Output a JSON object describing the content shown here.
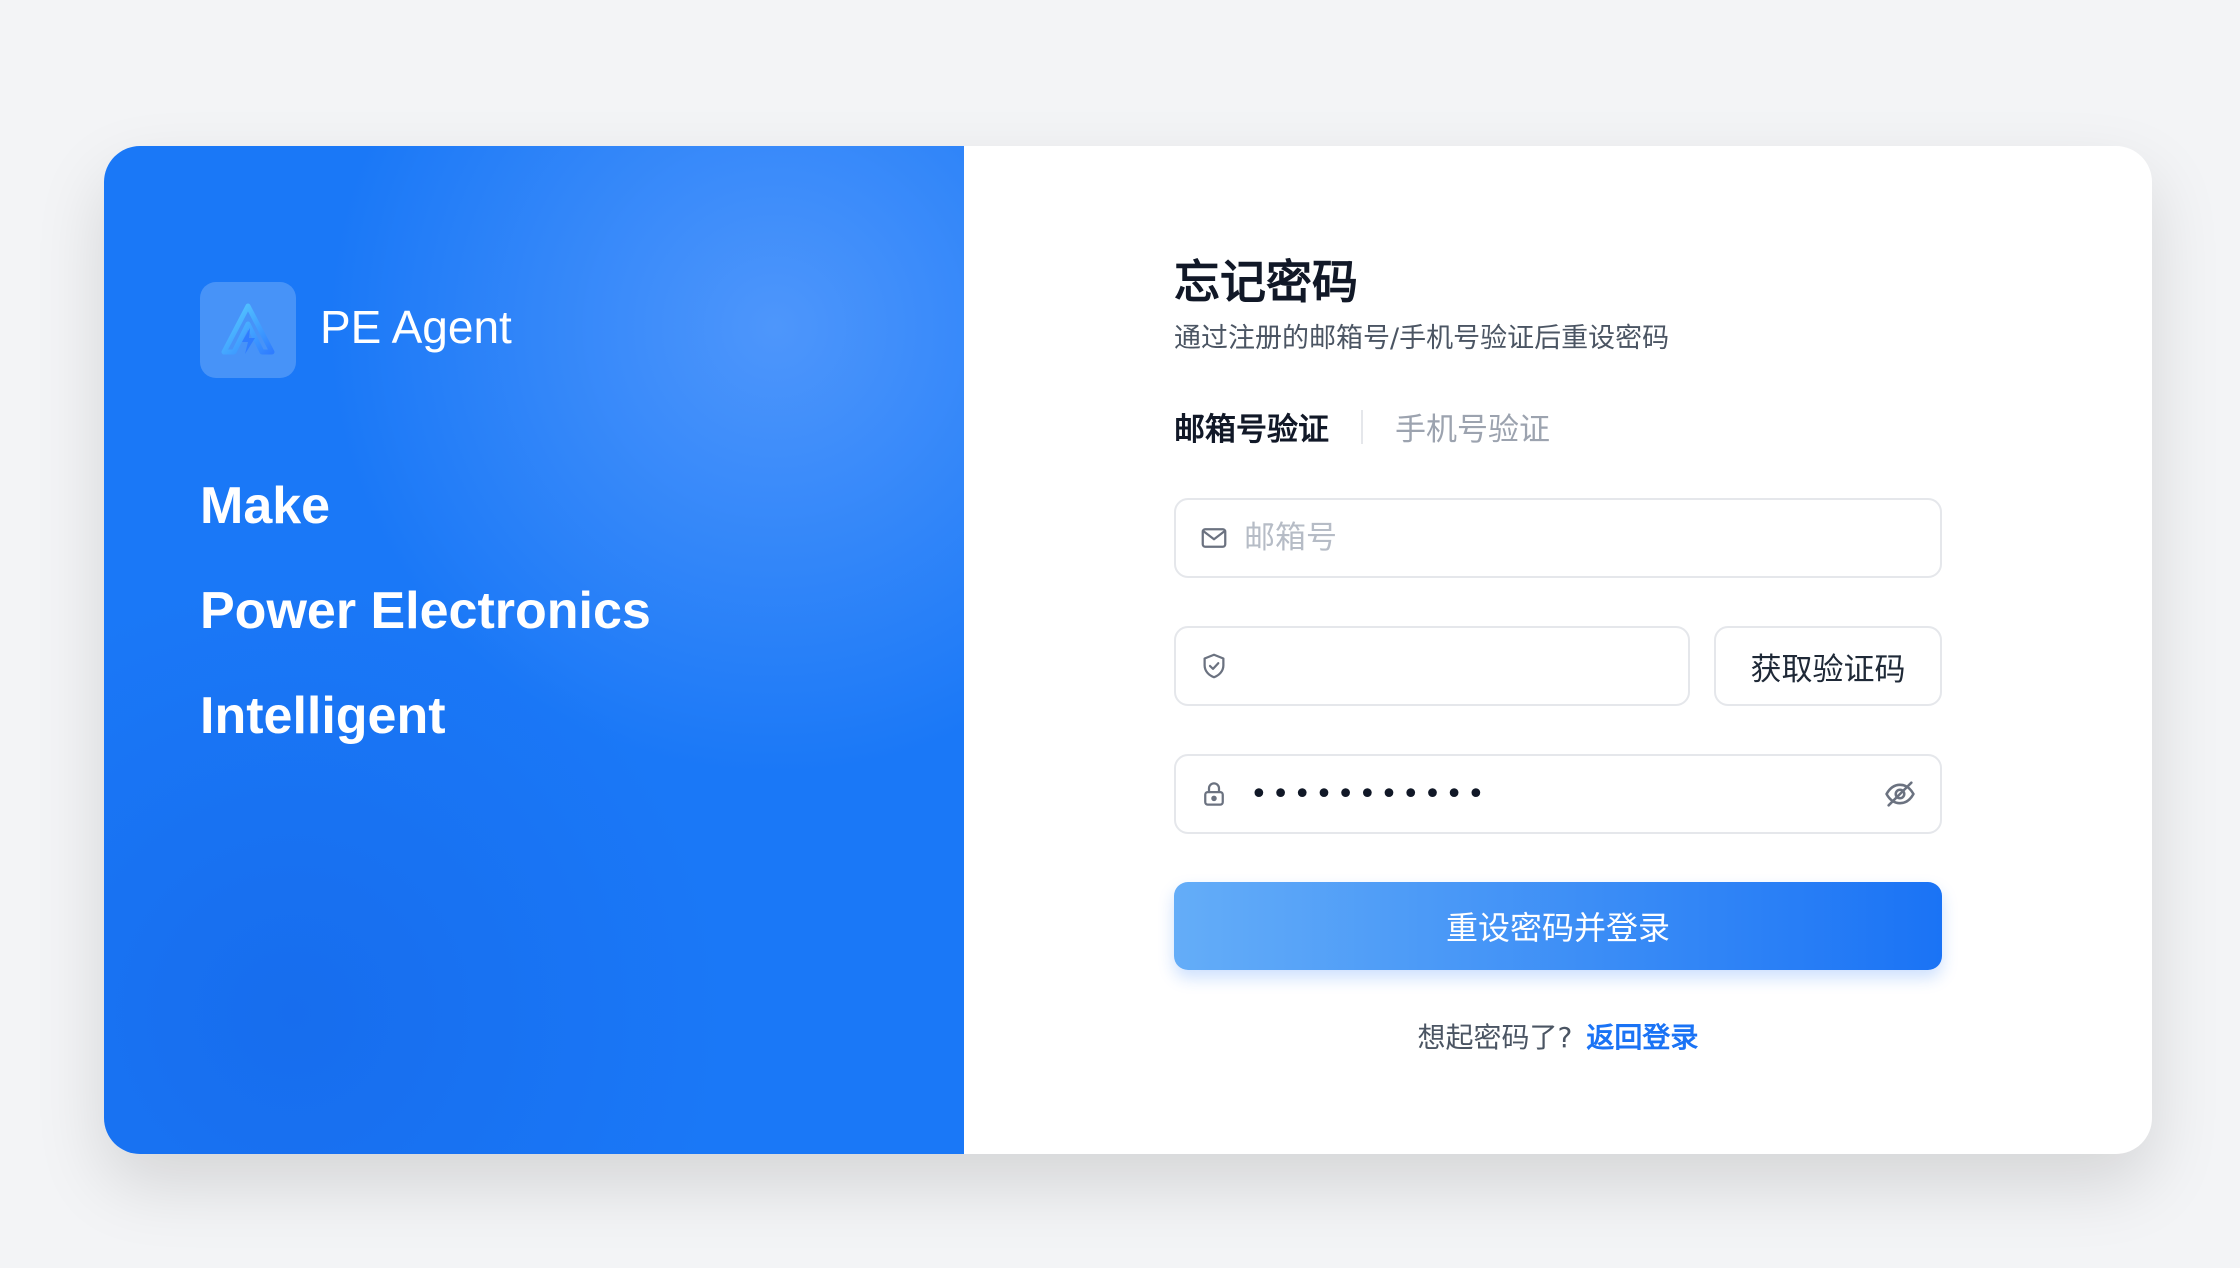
{
  "brand": {
    "name": "PE Agent",
    "logo_icon": "lightning-arrow-icon",
    "slogan": [
      "Make",
      "Power Electronics",
      "Intelligent"
    ]
  },
  "form": {
    "title": "忘记密码",
    "subtitle": "通过注册的邮箱号/手机号验证后重设密码",
    "tabs": [
      {
        "label": "邮箱号验证",
        "active": true
      },
      {
        "label": "手机号验证",
        "active": false
      }
    ],
    "email": {
      "placeholder": "邮箱号",
      "value": "",
      "icon": "mail-icon"
    },
    "code": {
      "placeholder": "",
      "value": "",
      "icon": "shield-check-icon",
      "button_label": "获取验证码"
    },
    "password": {
      "masked_value": "•••••••••••",
      "icon": "lock-icon",
      "toggle_icon": "eye-off-icon"
    },
    "submit_label": "重设密码并登录",
    "footer": {
      "prompt": "想起密码了?",
      "link_label": "返回登录"
    }
  },
  "colors": {
    "brand_blue": "#1a78f7",
    "primary": "#1a73f5",
    "page_bg": "#f3f4f6",
    "text_dark": "#111827",
    "text_muted": "#9ca3af"
  }
}
